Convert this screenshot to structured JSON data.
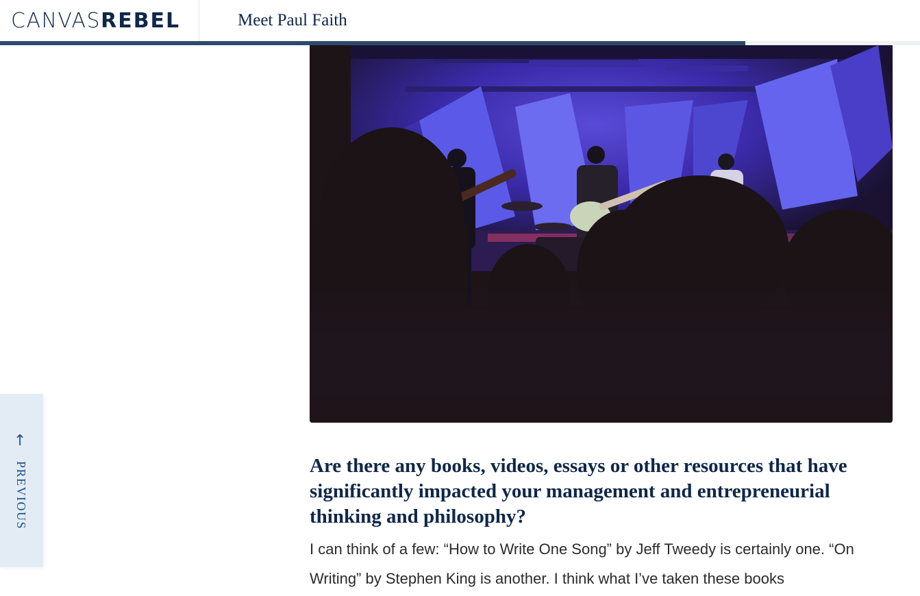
{
  "header": {
    "logo_light": "CANVAS",
    "logo_bold": "REBEL",
    "title": "Meet Paul Faith"
  },
  "progress": {
    "fraction": 0.81
  },
  "photo": {
    "icon": "concert-photo"
  },
  "side_nav": {
    "arrow": "↑",
    "label": "PREVIOUS"
  },
  "article": {
    "question": "Are there any books, videos, essays or other resources that have significantly impacted your management and entrepreneurial thinking and philosophy?",
    "answer": "I can think of a few: “How to Write One Song” by Jeff Tweedy is certainly one. “On Writing” by Stephen King is another. I think what I’ve taken these books"
  },
  "colors": {
    "brand_navy": "#0f2748",
    "progress": "#2e4a6b",
    "side_tab_bg": "#e3ecf5",
    "side_tab_text": "#1f4e8c"
  }
}
